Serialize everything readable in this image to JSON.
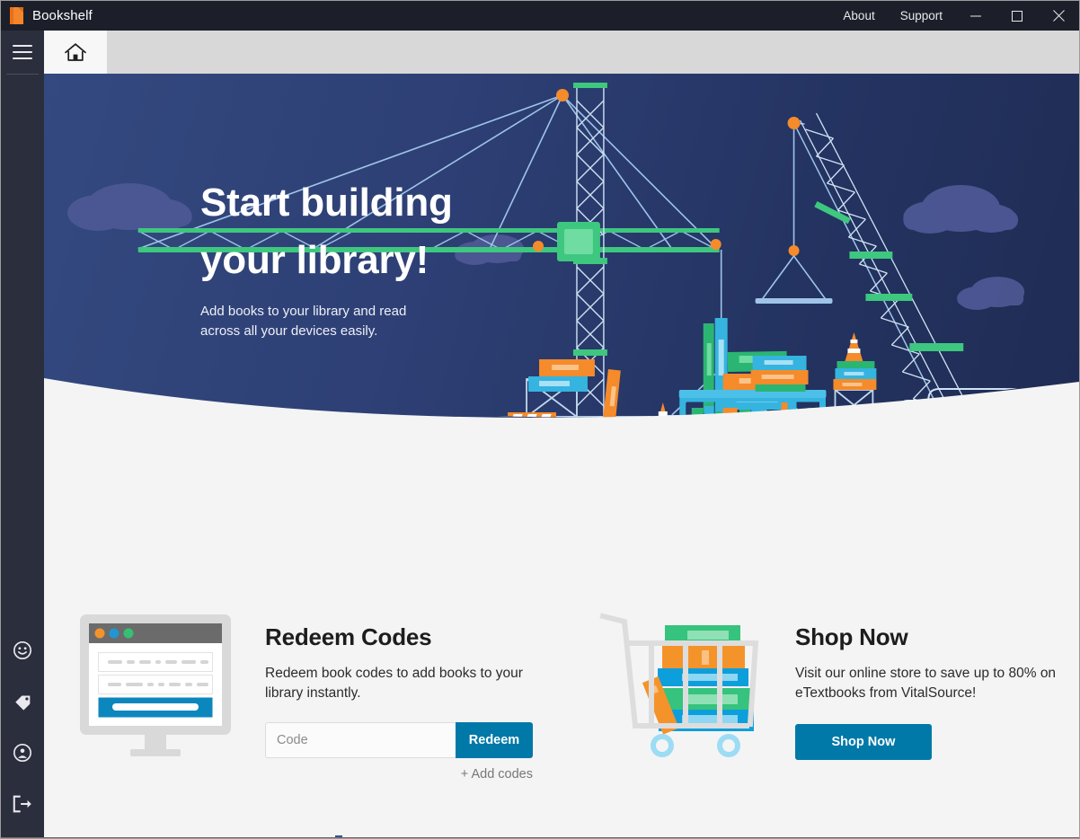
{
  "window": {
    "title": "Bookshelf",
    "logo_icon": "bookshelf-logo-icon",
    "links": [
      {
        "label": "About",
        "name": "about-link"
      },
      {
        "label": "Support",
        "name": "support-link"
      }
    ],
    "controls": {
      "minimize": "minimize-icon",
      "maximize": "maximize-icon",
      "close": "close-icon"
    }
  },
  "sidebar": {
    "menu_icon": "hamburger-menu-icon",
    "bottom_items": [
      {
        "icon": "smiley-face-icon",
        "name": "sidebar-item-feedback"
      },
      {
        "icon": "tag-icon",
        "name": "sidebar-item-offers"
      },
      {
        "icon": "account-circle-icon",
        "name": "sidebar-item-account"
      },
      {
        "icon": "sign-out-icon",
        "name": "sidebar-item-sign-out"
      }
    ]
  },
  "tabs": [
    {
      "icon": "home-icon",
      "name": "tab-home",
      "active": true
    }
  ],
  "hero": {
    "heading_line1": "Start building",
    "heading_line2": "your library!",
    "subtext": "Add books to your library and read across all your devices easily.",
    "illustration": "construction-crane-bookshelf-illustration",
    "bg_color": "#2e4076"
  },
  "promos": {
    "redeem": {
      "illustration": "browser-window-monitor-icon",
      "title": "Redeem Codes",
      "text": "Redeem book codes to add books to your library instantly.",
      "input_value": "",
      "input_placeholder": "Code",
      "button_label": "Redeem",
      "add_codes_label": "+ Add codes"
    },
    "shop": {
      "illustration": "shopping-cart-with-books-icon",
      "title": "Shop Now",
      "text": "Visit our online store to save up to 80% on eTextbooks from VitalSource!",
      "button_label": "Shop Now"
    }
  },
  "colors": {
    "titlebar": "#1c1e2a",
    "sidebar": "#2b2e3c",
    "tabstrip": "#d8d8d8",
    "accent_blue": "#0079a8",
    "hero_blue": "#2e4076",
    "logo_orange": "#f5852b"
  }
}
